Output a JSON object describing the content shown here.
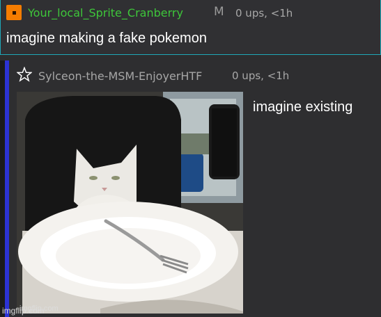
{
  "comment1": {
    "username": "Your_local_Sprite_Cranberry",
    "badge": "M",
    "meta": "0 ups, <1h",
    "text": "imagine making a fake pokemon",
    "badge_icon": "orange-square-icon",
    "user_color": "#3ec63a"
  },
  "comment2": {
    "username": "Sylceon-the-MSM-EnjoyerHTF",
    "meta": "0 ups, <1h",
    "text": "imagine existing",
    "badge_icon": "star-icon",
    "thread_bar_color": "#2c33d6"
  },
  "image": {
    "description_icon": "cat-at-table-photo",
    "watermark": "imgflip.com"
  },
  "footer": {
    "watermark": "imgflip.com"
  },
  "colors": {
    "background": "#2d2d2f",
    "accent_border": "#1fa8b8"
  }
}
